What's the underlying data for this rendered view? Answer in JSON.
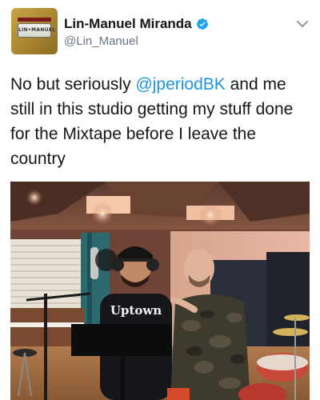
{
  "tweet": {
    "display_name": "Lin-Manuel Miranda",
    "handle": "@Lin_Manuel",
    "verified": true,
    "avatar": {
      "plate_text": "LIN•MANUEL",
      "icon": "license-plate-avatar"
    },
    "text_prefix": "No but seriously ",
    "mention": "@jperiodBK",
    "text_suffix": " and me still in this studio getting my stuff done for the Mixtape before I leave the country",
    "photo": {
      "shirt_text": "Uptown"
    },
    "icons": {
      "verified": "verified-badge-icon",
      "menu": "chevron-down-icon"
    },
    "colors": {
      "name": "#14171a",
      "handle": "#657786",
      "mention": "#1b95e0",
      "verified": "#1da1f2"
    }
  }
}
